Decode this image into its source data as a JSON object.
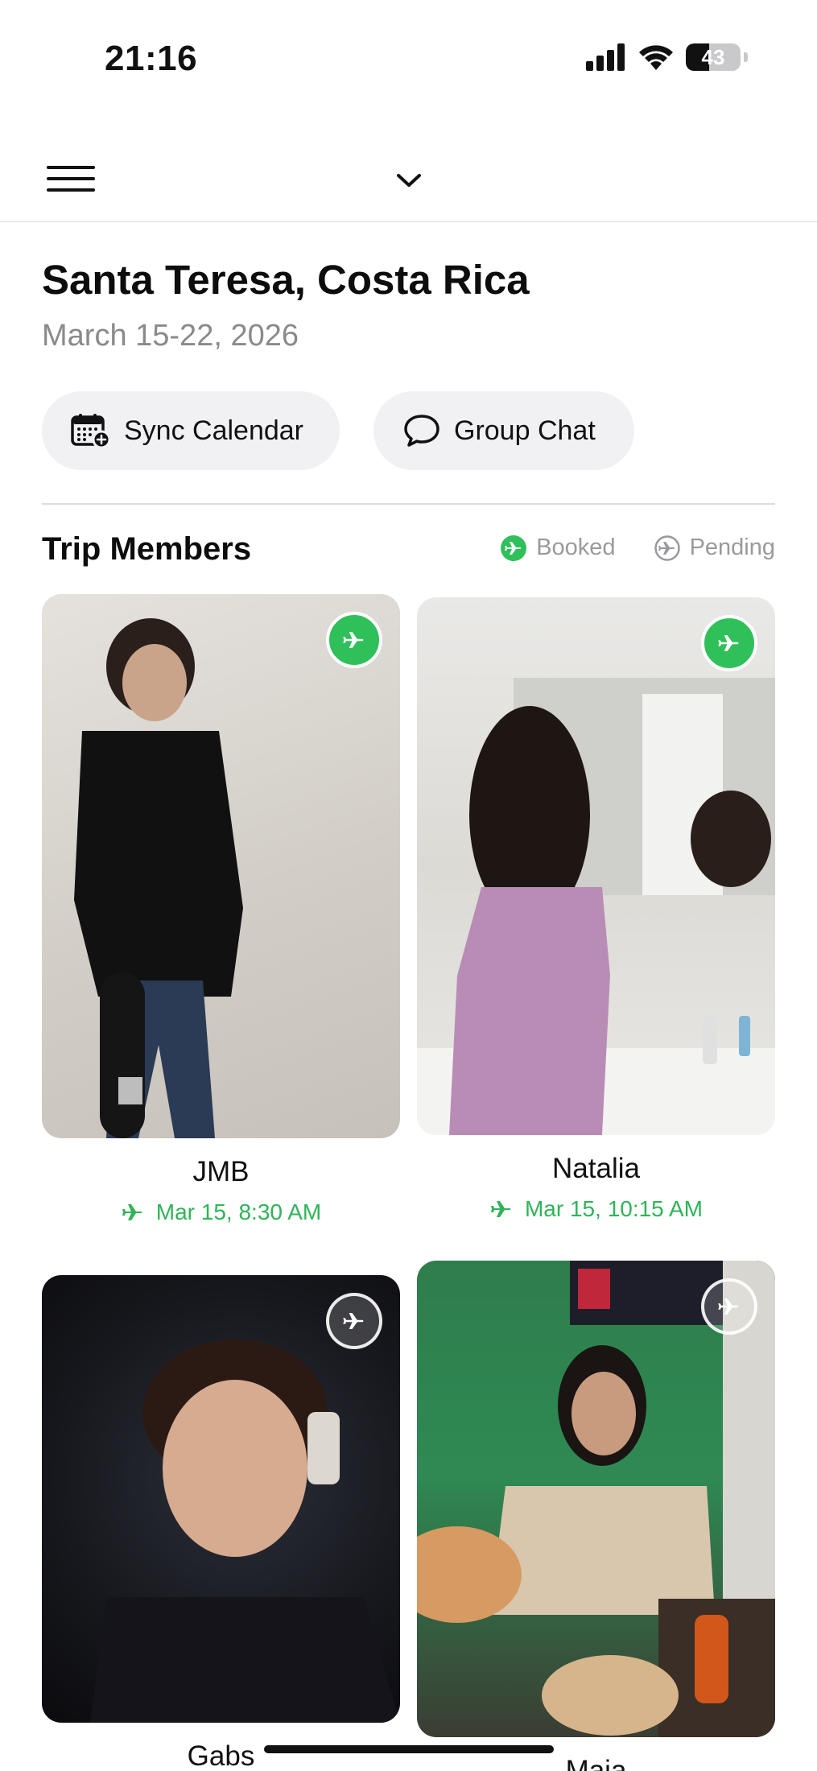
{
  "status_bar": {
    "time": "21:16",
    "battery": "43",
    "battery_level": 0.43
  },
  "trip": {
    "title": "Santa Teresa, Costa Rica",
    "dates": "March 15-22, 2026"
  },
  "actions": {
    "sync_calendar": "Sync Calendar",
    "group_chat": "Group Chat"
  },
  "members_section": {
    "title": "Trip Members",
    "legend_booked": "Booked",
    "legend_pending": "Pending"
  },
  "members": [
    {
      "name": "JMB",
      "status": "booked",
      "flight": "Mar 15, 8:30 AM"
    },
    {
      "name": "Natalia",
      "status": "booked",
      "flight": "Mar 15, 10:15 AM"
    },
    {
      "name": "Gabs",
      "status": "pending",
      "flight": ""
    },
    {
      "name": "Maia",
      "status": "pending",
      "flight": ""
    }
  ],
  "colors": {
    "booked": "#2fc05a",
    "pending": "#9a9a9e",
    "pill_bg": "#f1f1f3"
  },
  "icons": [
    "menu-icon",
    "chevron-down-icon",
    "calendar-plus-icon",
    "chat-bubble-icon",
    "plane-icon",
    "signal-icon",
    "wifi-icon",
    "battery-icon"
  ]
}
